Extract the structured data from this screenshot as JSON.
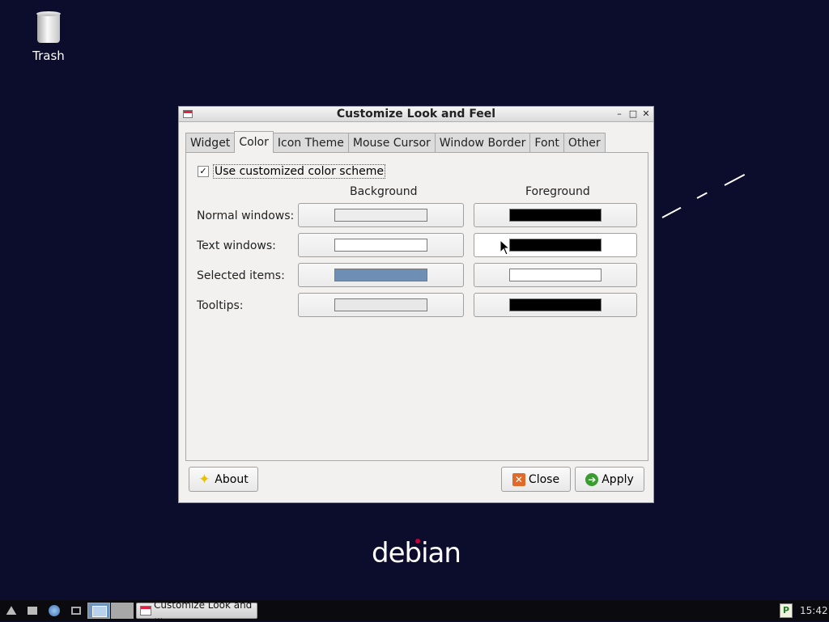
{
  "desktop": {
    "trash_label": "Trash",
    "logo_text": "debian"
  },
  "window": {
    "title": "Customize Look and Feel",
    "controls": {
      "minimize": "–",
      "maximize": "□",
      "close": "✕"
    },
    "tabs": [
      {
        "label": "Widget",
        "active": false
      },
      {
        "label": "Color",
        "active": true
      },
      {
        "label": "Icon Theme",
        "active": false
      },
      {
        "label": "Mouse Cursor",
        "active": false
      },
      {
        "label": "Window Border",
        "active": false
      },
      {
        "label": "Font",
        "active": false
      },
      {
        "label": "Other",
        "active": false
      }
    ],
    "color_tab": {
      "use_custom_label": "Use customized color scheme",
      "use_custom_checked": true,
      "headers": {
        "background": "Background",
        "foreground": "Foreground"
      },
      "rows": [
        {
          "label": "Normal windows:",
          "background": "#ededed",
          "foreground": "#000000"
        },
        {
          "label": "Text windows:",
          "background": "#ffffff",
          "foreground": "#000000"
        },
        {
          "label": "Selected items:",
          "background": "#6e8fb3",
          "foreground": "#ffffff"
        },
        {
          "label": "Tooltips:",
          "background": "#e8e8e8",
          "foreground": "#000000"
        }
      ]
    },
    "buttons": {
      "about": "About",
      "close": "Close",
      "apply": "Apply"
    }
  },
  "taskbar": {
    "task_label": "Customize Look and ...",
    "clock": "15:42",
    "tray_icon_letter": "P"
  }
}
